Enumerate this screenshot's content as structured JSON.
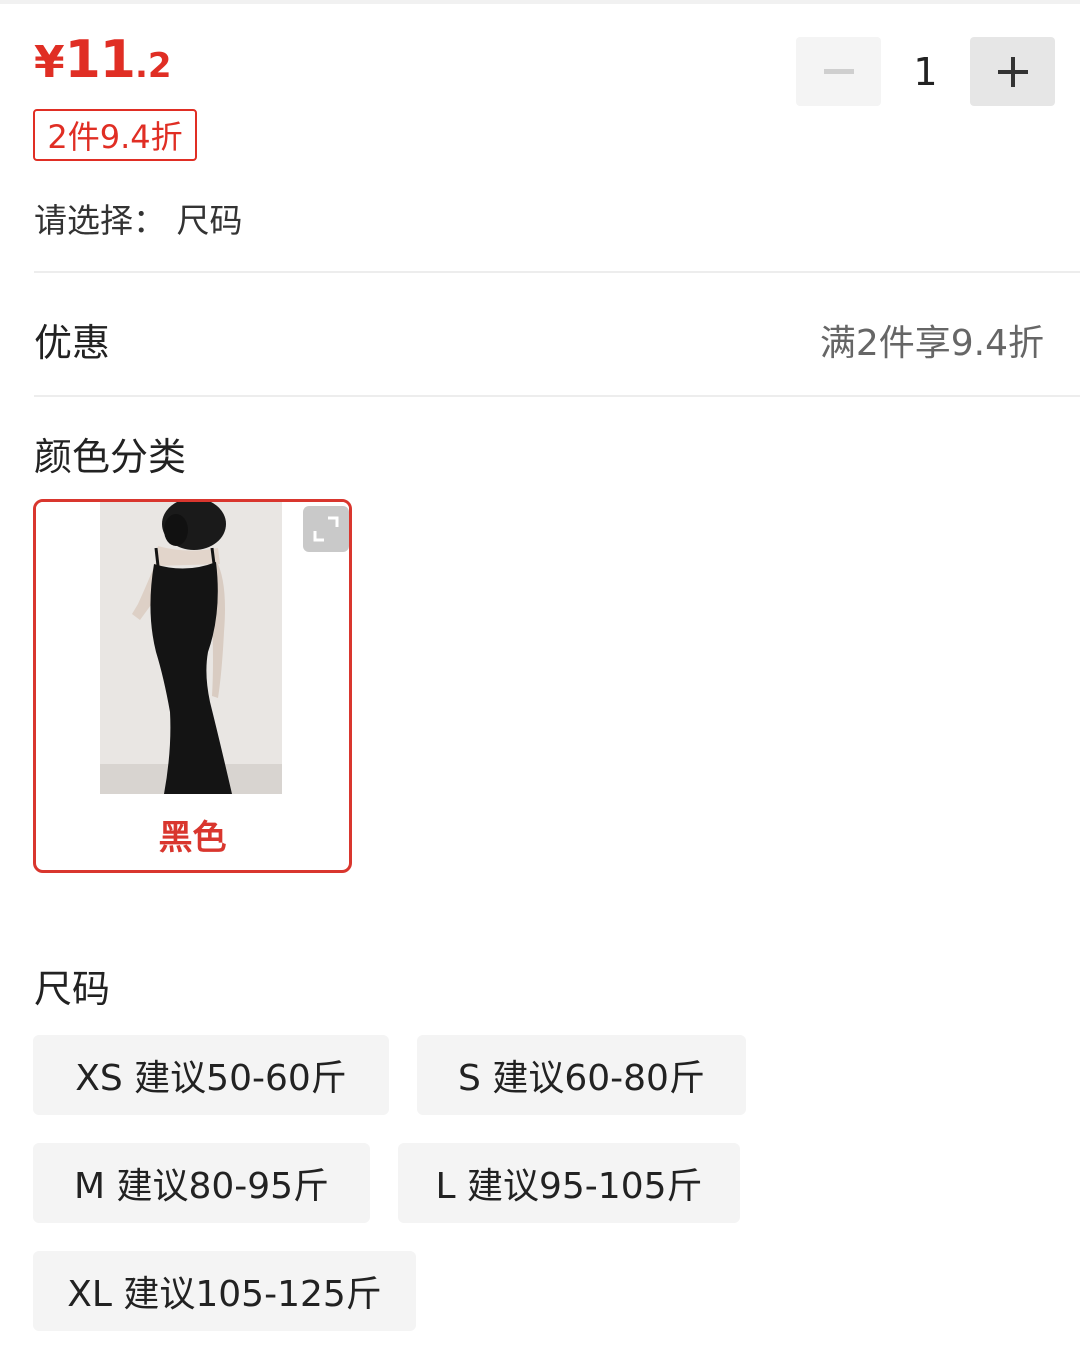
{
  "price": {
    "currency": "¥",
    "integer": "11",
    "decimal": ".2",
    "color": "#e02e24"
  },
  "discount_badge": "2件9.4折",
  "quantity": {
    "value": "1",
    "minus_icon": "minus-icon",
    "plus_icon": "plus-icon"
  },
  "selection_prompt": "请选择：  尺码",
  "promotion": {
    "label": "优惠",
    "value": "满2件享9.4折"
  },
  "color_section": {
    "title": "颜色分类",
    "options": [
      {
        "label": "黑色",
        "selected": true,
        "image": "black-slip-dress-photo",
        "expand_icon": "expand-icon"
      }
    ]
  },
  "size_section": {
    "title": "尺码",
    "options": [
      {
        "label": "XS 建议50-60斤"
      },
      {
        "label": "S 建议60-80斤"
      },
      {
        "label": "M 建议80-95斤"
      },
      {
        "label": "L 建议95-105斤"
      },
      {
        "label": "XL 建议105-125斤"
      }
    ]
  },
  "accent_color": "#e02e24"
}
